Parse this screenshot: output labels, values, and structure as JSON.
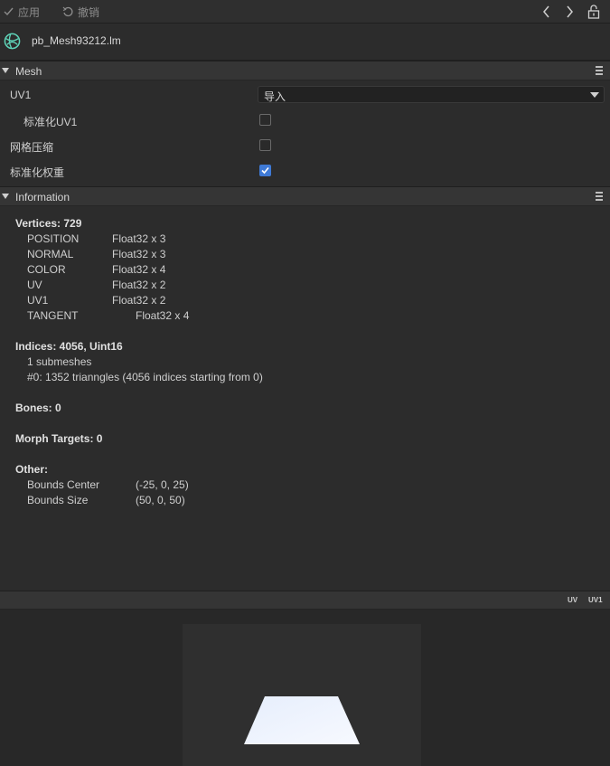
{
  "toolbar": {
    "apply_label": "应用",
    "revert_label": "撤销"
  },
  "asset": {
    "name": "pb_Mesh93212.lm"
  },
  "mesh_section": {
    "title": "Mesh",
    "uv1_label": "UV1",
    "uv1_value": "导入",
    "normalize_uv1_label": "标准化UV1",
    "normalize_uv1_checked": false,
    "mesh_compression_label": "网格压缩",
    "mesh_compression_checked": false,
    "normalize_weights_label": "标准化权重",
    "normalize_weights_checked": true
  },
  "info_section": {
    "title": "Information",
    "vertices_heading": "Vertices: 729",
    "attributes": [
      {
        "name": "POSITION",
        "format": "Float32 x 3"
      },
      {
        "name": "NORMAL",
        "format": "Float32 x 3"
      },
      {
        "name": "COLOR",
        "format": "Float32 x 4"
      },
      {
        "name": "UV",
        "format": "Float32 x 2"
      },
      {
        "name": "UV1",
        "format": "Float32 x 2"
      },
      {
        "name": "TANGENT",
        "format": "Float32 x 4"
      }
    ],
    "indices_heading": "Indices: 4056, Uint16",
    "submeshes": "1 submeshes",
    "submesh_0": "#0: 1352 trianngles (4056 indices starting from 0)",
    "bones": "Bones: 0",
    "morph_targets": "Morph Targets: 0",
    "other_heading": "Other:",
    "bounds_center_label": "Bounds Center",
    "bounds_center_value": "(-25, 0, 25)",
    "bounds_size_label": "Bounds Size",
    "bounds_size_value": "(50, 0, 50)"
  },
  "preview": {
    "uv_tab": "UV",
    "uv1_tab": "UV1"
  },
  "colors": {
    "accent": "#3f7ad6",
    "asset_icon": "#5fd3b8"
  },
  "icons": {
    "apply": "check-icon",
    "revert": "undo-icon",
    "back": "chevron-left-icon",
    "forward": "chevron-right-icon",
    "lock": "unlock-icon",
    "asset": "mesh-globe-icon"
  }
}
